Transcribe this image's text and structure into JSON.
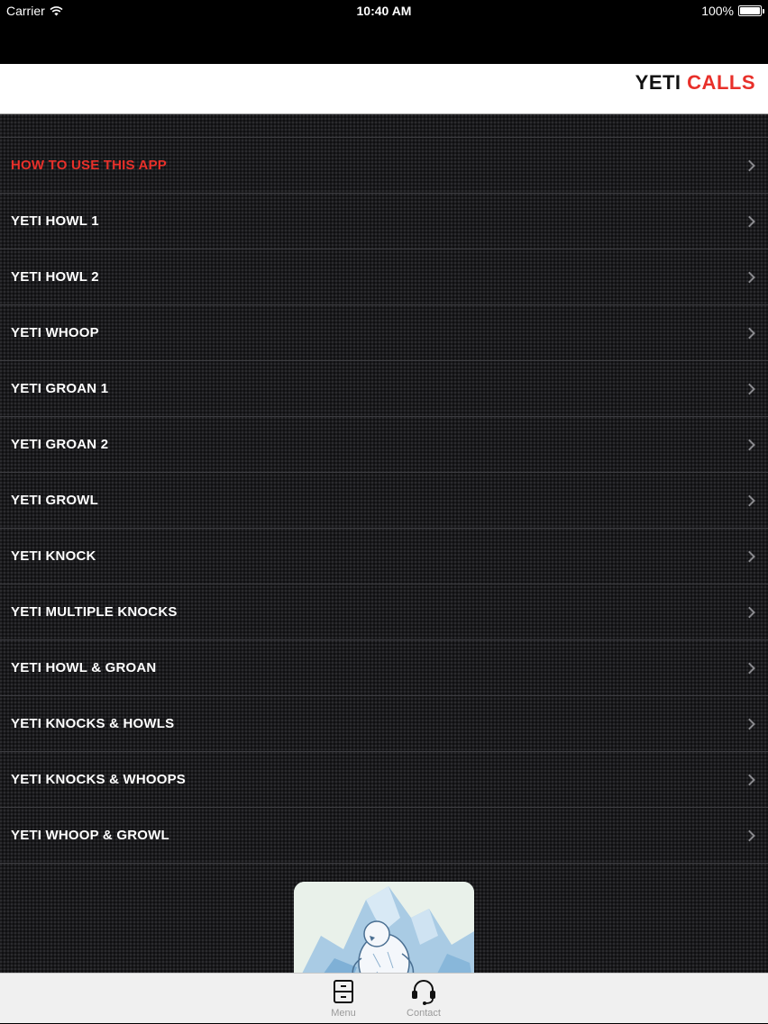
{
  "status_bar": {
    "carrier": "Carrier",
    "time": "10:40 AM",
    "battery": "100%"
  },
  "nav": {
    "title_part1": "YETI",
    "title_part2": "CALLS",
    "accent_color": "#e8302a"
  },
  "menu": {
    "items": [
      {
        "label": "HOW TO USE THIS APP",
        "highlight": true
      },
      {
        "label": "YETI HOWL 1"
      },
      {
        "label": "YETI HOWL 2"
      },
      {
        "label": "YETI WHOOP"
      },
      {
        "label": "YETI GROAN 1"
      },
      {
        "label": "YETI GROAN 2"
      },
      {
        "label": "YETI GROWL"
      },
      {
        "label": "YETI KNOCK"
      },
      {
        "label": "YETI MULTIPLE KNOCKS"
      },
      {
        "label": "YETI HOWL & GROAN"
      },
      {
        "label": "YETI KNOCKS & HOWLS"
      },
      {
        "label": "YETI KNOCKS & WHOOPS"
      },
      {
        "label": "YETI WHOOP & GROWL"
      }
    ]
  },
  "tabs": {
    "menu_label": "Menu",
    "contact_label": "Contact"
  },
  "icons": {
    "wifi": "wifi-icon",
    "battery": "battery-icon",
    "chevron": "chevron-right-icon",
    "menu": "file-cabinet-icon",
    "contact": "headset-icon"
  }
}
